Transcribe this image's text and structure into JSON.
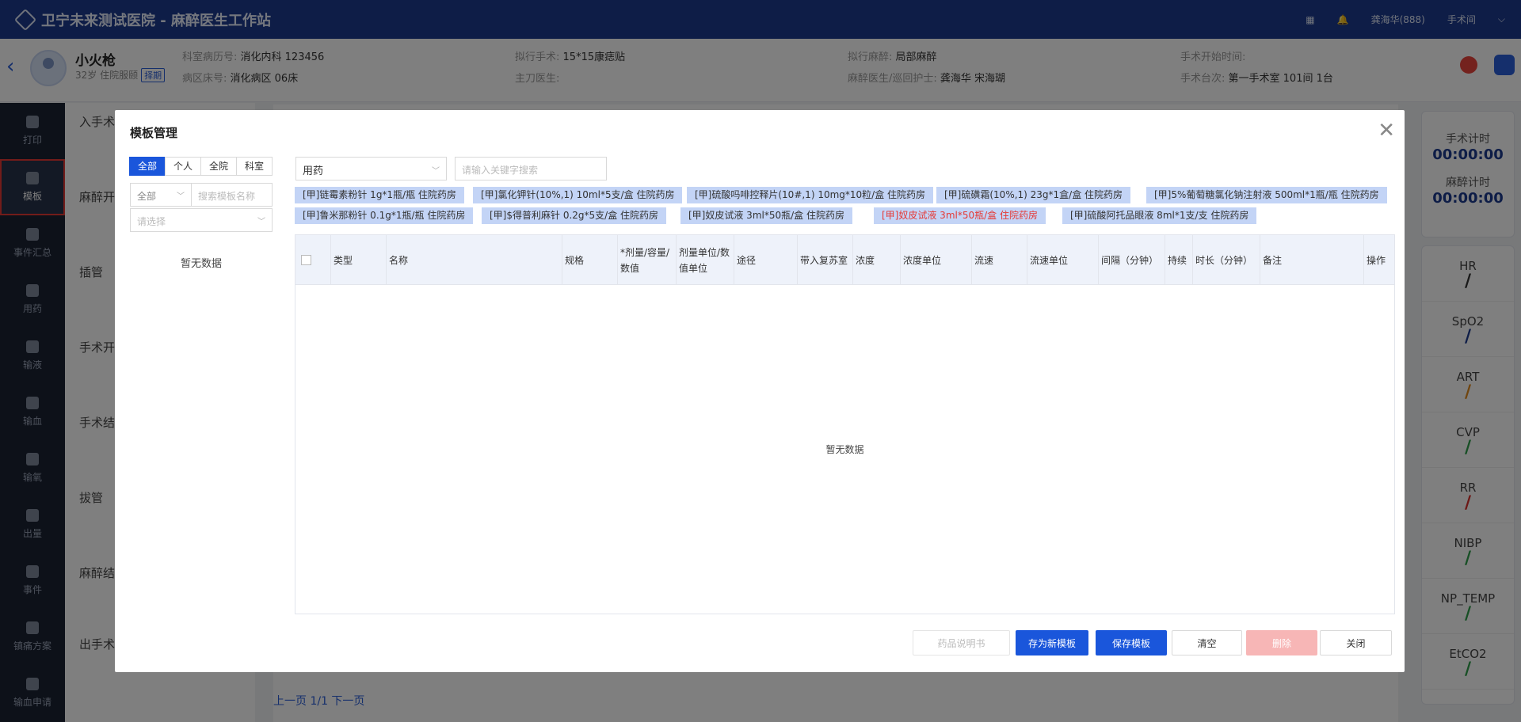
{
  "app": {
    "title": "卫宁未来测试医院 - 麻醉医生工作站",
    "user": "龚海华(888)",
    "user_menu": "手术间"
  },
  "patient": {
    "name": "小火枪",
    "meta": "32岁 住院服颐",
    "badge": "择期",
    "fields": [
      {
        "label": "科室病历号:",
        "value": "消化内科 123456"
      },
      {
        "label": "病区床号:",
        "value": "消化病区 06床"
      },
      {
        "label": "拟行手术:",
        "value": "15*15康痣贴"
      },
      {
        "label": "主刀医生:",
        "value": ""
      },
      {
        "label": "拟行麻醉:",
        "value": "局部麻醉"
      },
      {
        "label": "麻醉医生/巡回护士:",
        "value": "龚海华 宋海瑚"
      },
      {
        "label": "手术开始时间:",
        "value": ""
      },
      {
        "label": "手术台次:",
        "value": "第一手术室 101间 1台"
      }
    ]
  },
  "sidebar": {
    "items": [
      {
        "label": "打印",
        "icon": "printer-icon"
      },
      {
        "label": "模板",
        "icon": "template-icon",
        "active": true
      },
      {
        "label": "事件汇总",
        "icon": "event-summary-icon"
      },
      {
        "label": "用药",
        "icon": "medication-icon"
      },
      {
        "label": "输液",
        "icon": "infusion-icon"
      },
      {
        "label": "输血",
        "icon": "transfusion-icon"
      },
      {
        "label": "输氧",
        "icon": "oxygen-icon"
      },
      {
        "label": "出量",
        "icon": "output-icon"
      },
      {
        "label": "事件",
        "icon": "event-icon"
      },
      {
        "label": "镇痛方案",
        "icon": "analgesia-icon"
      },
      {
        "label": "输血申请",
        "icon": "blood-request-icon"
      }
    ]
  },
  "background": {
    "steps": [
      "入手术",
      "麻醉开",
      "插管",
      "手术开",
      "手术结",
      "拔管",
      "麻醉结",
      "出手术"
    ],
    "timers": [
      {
        "label": "手术计时",
        "value": "00:00:00"
      },
      {
        "label": "麻醉计时",
        "value": "00:00:00"
      }
    ],
    "vitals": [
      {
        "name": "HR",
        "value": "/",
        "color": "#333333"
      },
      {
        "name": "SpO2",
        "value": "/",
        "color": "#1d3a8f"
      },
      {
        "name": "ART",
        "value": "/",
        "color": "#e08a1e"
      },
      {
        "name": "CVP",
        "value": "/",
        "color": "#2e9e4a"
      },
      {
        "name": "RR",
        "value": "/",
        "color": "#d9302c"
      },
      {
        "name": "NIBP",
        "value": "/",
        "color": "#2e9e4a"
      },
      {
        "name": "NP_TEMP",
        "value": "/",
        "color": "#2e9e4a"
      },
      {
        "name": "EtCO2",
        "value": "/",
        "color": "#2e9e4a"
      }
    ],
    "pager": "上一页 1/1 下一页"
  },
  "modal": {
    "title": "模板管理",
    "scope_tabs": [
      "全部",
      "个人",
      "全院",
      "科室"
    ],
    "left": {
      "filter_value": "全部",
      "search_placeholder": "搜索模板名称",
      "select_placeholder": "请选择",
      "empty": "暂无数据"
    },
    "right": {
      "type_value": "用药",
      "keyword_placeholder": "请输入关键字搜索",
      "drug_tags": [
        {
          "text": "[甲]链霉素粉针 1g*1瓶/瓶 住院药房",
          "red": false
        },
        {
          "text": "[甲]氯化钾针(10%,1) 10ml*5支/盒 住院药房",
          "red": false
        },
        {
          "text": "[甲]硫酸吗啡控释片(10#,1) 10mg*10粒/盒 住院药房",
          "red": false
        },
        {
          "text": "[甲]硫磺霜(10%,1) 23g*1盒/盒 住院药房",
          "red": false
        },
        {
          "text": "[甲]5%葡萄糖氯化钠注射液 500ml*1瓶/瓶 住院药房",
          "red": false
        },
        {
          "text": "[甲]鲁米那粉针 0.1g*1瓶/瓶 住院药房",
          "red": false
        },
        {
          "text": "[甲]$得普利麻针 0.2g*5支/盒 住院药房",
          "red": false
        },
        {
          "text": "[甲]奴皮试液 3ml*50瓶/盒 住院药房",
          "red": false
        },
        {
          "text": "[甲]奴皮试液 3ml*50瓶/盒 住院药房",
          "red": true
        },
        {
          "text": "[甲]硫酸阿托品眼液 8ml*1支/支 住院药房",
          "red": false
        }
      ],
      "columns": [
        "类型",
        "名称",
        "规格",
        "*剂量/容量/数值",
        "剂量单位/数值单位",
        "途径",
        "带入复苏室",
        "浓度",
        "浓度单位",
        "流速",
        "流速单位",
        "间隔（分钟）",
        "持续",
        "时长（分钟）",
        "备注",
        "操作"
      ],
      "empty": "暂无数据"
    },
    "buttons": {
      "manual": "药品说明书",
      "save_new": "存为新模板",
      "save": "保存模板",
      "clear": "清空",
      "delete": "删除",
      "close": "关闭"
    }
  }
}
